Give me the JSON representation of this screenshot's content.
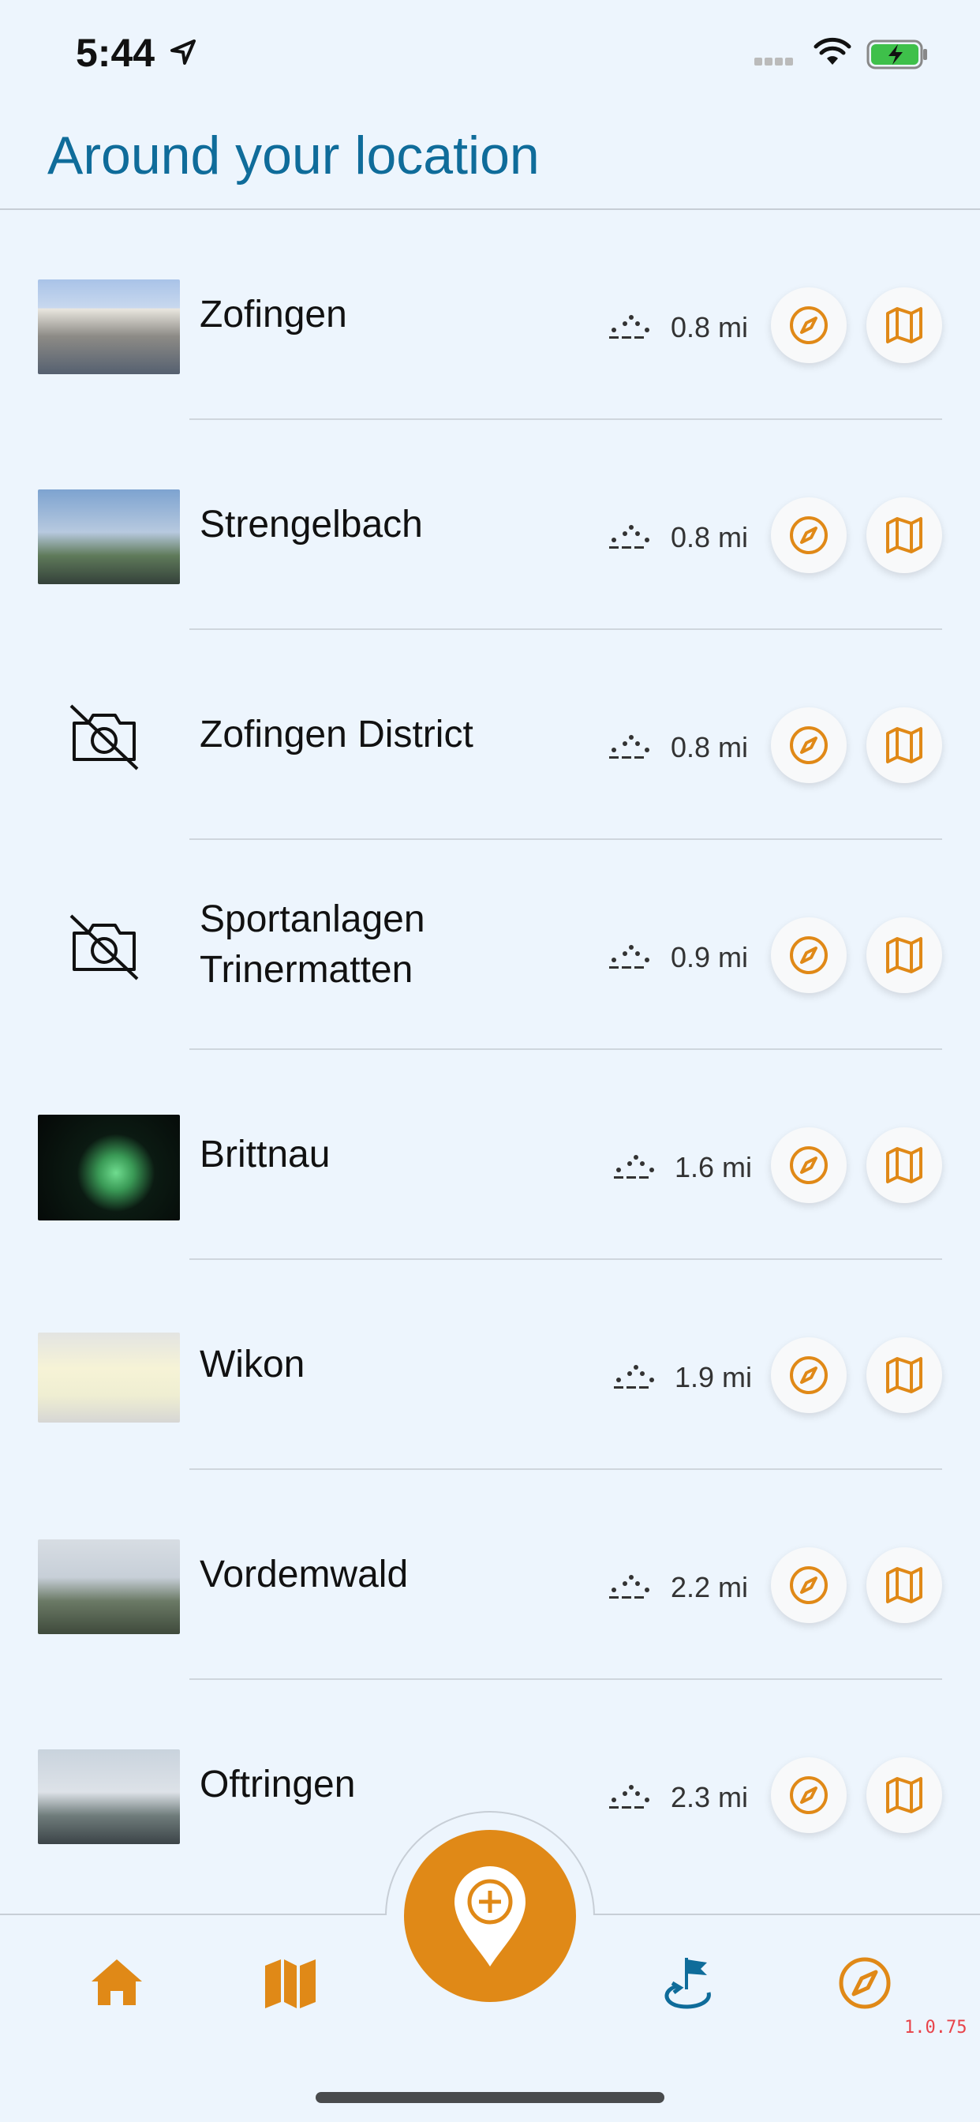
{
  "status_bar": {
    "time": "5:44"
  },
  "header": {
    "title": "Around your location"
  },
  "places": [
    {
      "name": "Zofingen",
      "distance": "0.8 mi",
      "has_photo": true
    },
    {
      "name": "Strengelbach",
      "distance": "0.8 mi",
      "has_photo": true
    },
    {
      "name": "Zofingen District",
      "distance": "0.8 mi",
      "has_photo": false
    },
    {
      "name": "Sportanlagen Trinermatten",
      "name_line1": "Sportanlagen",
      "name_line2": "Trinermatten",
      "distance": "0.9 mi",
      "has_photo": false
    },
    {
      "name": "Brittnau",
      "distance": "1.6 mi",
      "has_photo": true
    },
    {
      "name": "Wikon",
      "distance": "1.9 mi",
      "has_photo": true
    },
    {
      "name": "Vordemwald",
      "distance": "2.2 mi",
      "has_photo": true
    },
    {
      "name": "Oftringen",
      "distance": "2.3 mi",
      "has_photo": true
    }
  ],
  "row_icons": {
    "walk": "walk-dots-icon",
    "compass": "compass-icon",
    "map": "map-icon"
  },
  "tab_bar": {
    "items": [
      "home-icon",
      "map-icon",
      "add-location-icon",
      "flag-route-icon",
      "compass-icon"
    ],
    "version": "1.0.75"
  },
  "colors": {
    "accent": "#e08917",
    "title": "#0f6c9a",
    "background": "#edf5fd",
    "active_tab": "#0f6c9a"
  }
}
